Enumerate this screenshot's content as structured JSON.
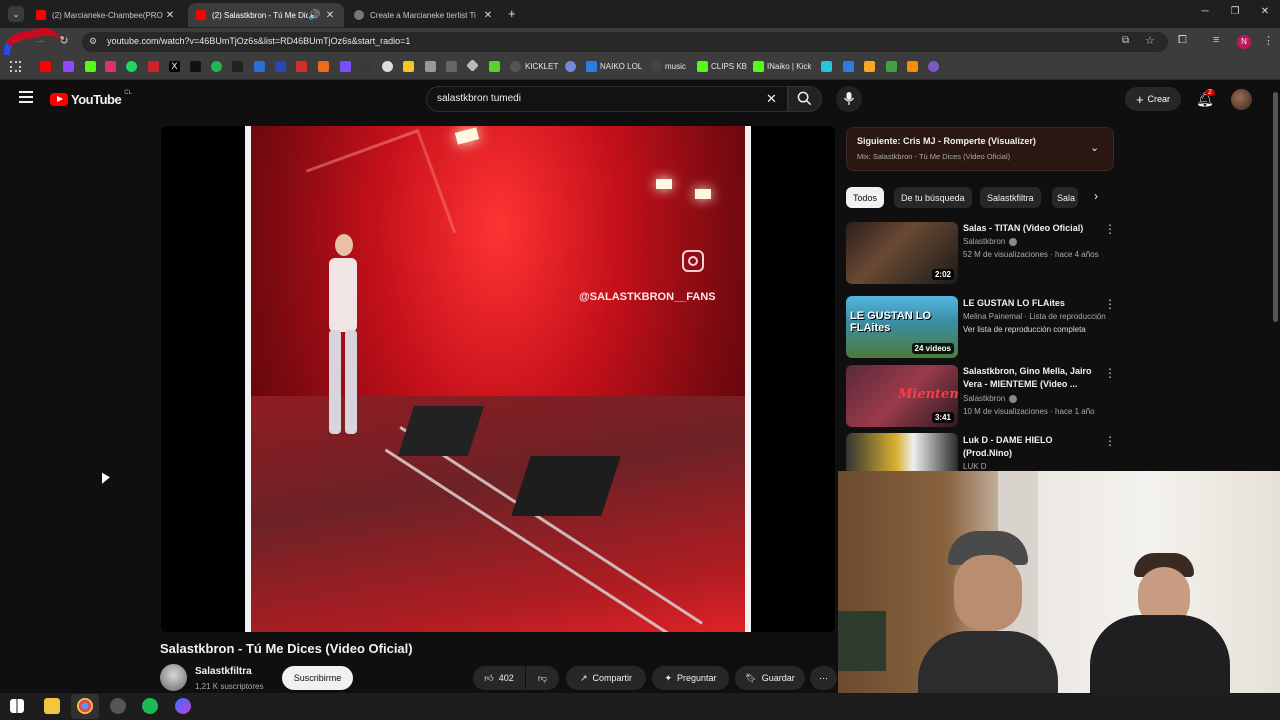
{
  "browser": {
    "tabs": [
      {
        "title": "(2) Marcianeke-Chambee(PRO",
        "active": false
      },
      {
        "title": "(2) Salastkbron - Tú Me Dic",
        "active": true
      },
      {
        "title": "Create a Marcianeke tierlist Ti",
        "active": false
      }
    ],
    "url": "youtube.com/watch?v=46BUmTjOz6s&list=RD46BUmTjOz6s&start_radio=1",
    "bookmarks": [
      "KICKLET",
      "NAIKO LOL",
      "music",
      "CLIPS KB",
      "INaiko | Kick"
    ],
    "profile_initial": "N"
  },
  "youtube": {
    "logo": "YouTube",
    "region": "CL",
    "search_value": "salastkbron tumedi",
    "create_label": "Crear",
    "notifications": "2"
  },
  "video": {
    "overlay_text": "@SALASTKBRON__FANS",
    "title": "Salastkbron - Tú Me Dices (Video Oficial)",
    "channel": "Salastkfiltra",
    "subscribers": "1,21 K suscriptores",
    "subscribe_label": "Suscribirme",
    "likes": "402",
    "share_label": "Compartir",
    "ask_label": "Preguntar",
    "save_label": "Guardar"
  },
  "sidebar": {
    "next_title": "Siguiente: Cris MJ - Romperte (Visualizer)",
    "next_sub": "Mix: Salastkbron - Tú Me Dices (Video Oficial)",
    "chips": [
      "Todos",
      "De tu búsqueda",
      "Salastkfiltra",
      "Sala"
    ],
    "items": [
      {
        "title": "Salas - TITAN (Video Oficial)",
        "channel": "Salastkbron",
        "meta": "52 M de visualizaciones · hace 4 años",
        "badge": "2:02"
      },
      {
        "title": "LE GUSTAN LO FLAites",
        "channel": "Melina Painemal · Lista de reproducción",
        "meta": "Ver lista de reproducción completa",
        "badge": "24 videos",
        "thumb_text": "LE GUSTAN LO FLAites"
      },
      {
        "title": "Salastkbron, Gino Mella, Jairo Vera - MIENTEME (Video ...",
        "channel": "Salastkbron",
        "meta": "10 M de visualizaciones · hace 1 año",
        "badge": "3:41",
        "thumb_text": "Mienteme"
      },
      {
        "title": "Luk D - DAME HIELO (Prod.Nino)",
        "channel": "LUK D",
        "meta": "",
        "badge": ""
      }
    ]
  }
}
